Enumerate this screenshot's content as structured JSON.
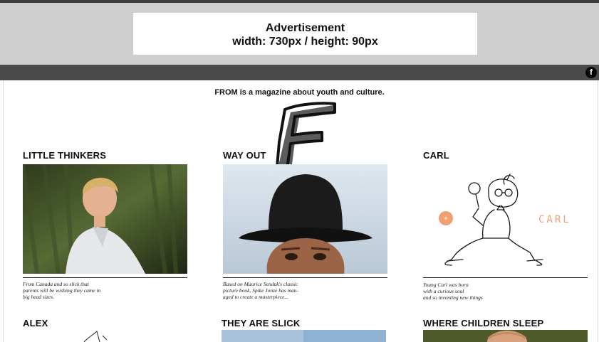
{
  "advertisement": {
    "title": "Advertisement",
    "size": "width: 730px / height: 90px"
  },
  "nav": {
    "facebook_glyph": "f"
  },
  "site": {
    "tagline": "FROM is a magazine about youth and culture."
  },
  "articles": [
    {
      "title": "LITTLE THINKERS",
      "caption": [
        "From Canada and so slick that",
        "parents will be wishing they came in",
        "big head sizes."
      ]
    },
    {
      "title": "WAY OUT",
      "caption": [
        "Based on Maurice Sendak's classic",
        "picture book, Spike Jonze has man-",
        "aged to create a masterpiece..."
      ]
    },
    {
      "title": "CARL",
      "image_text": "CARL",
      "caption": [
        "Young Carl was born",
        "with a curious soul",
        "and so inventing new things"
      ]
    },
    {
      "title": "ALEX"
    },
    {
      "title": "THEY ARE SLICK"
    },
    {
      "title": "WHERE CHILDREN SLEEP"
    }
  ],
  "colors": {
    "ad_band": "#cfcfcf",
    "nav_bar": "#4a4a4a",
    "accent_orange": "#f0a070"
  }
}
